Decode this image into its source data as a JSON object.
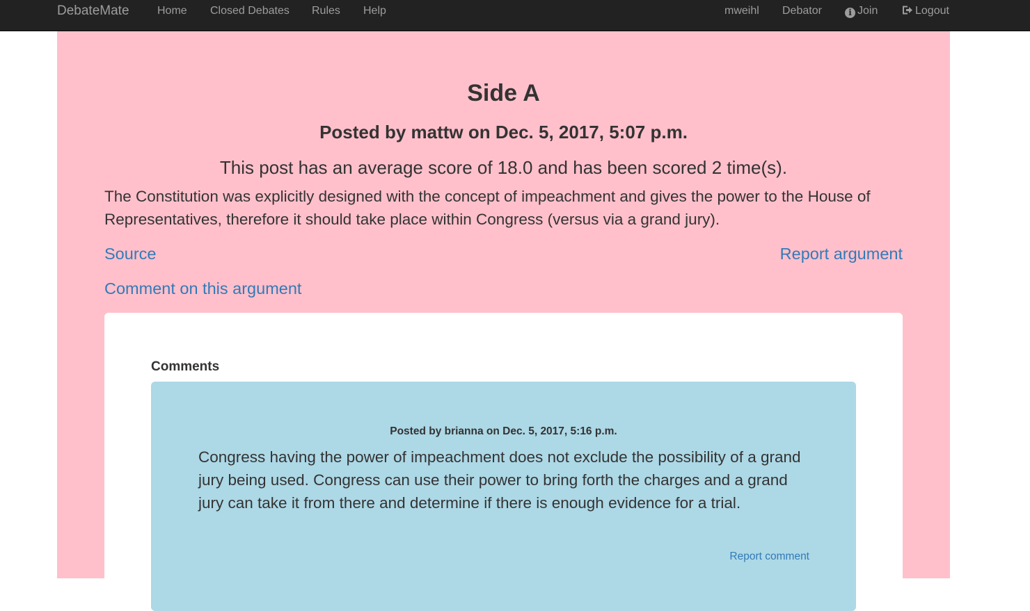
{
  "navbar": {
    "brand": "DebateMate",
    "links": [
      "Home",
      "Closed Debates",
      "Rules",
      "Help"
    ],
    "username": "mweihl",
    "role": "Debator",
    "join_label": "Join",
    "logout_label": "Logout"
  },
  "colors": {
    "navbar_bg": "#222222",
    "panel_bg": "#ffc0cb",
    "comment_bg": "#add8e6",
    "link": "#337ab7"
  },
  "argument": {
    "side_title": "Side A",
    "posted_by": "Posted by mattw on Dec. 5, 2017, 5:07 p.m.",
    "score_line": "This post has an average score of 18.0 and has been scored 2 time(s).",
    "text": "The Constitution was explicitly designed with the concept of impeachment and gives the power to the House of Representatives, therefore it should take place within Congress (versus via a grand jury).",
    "source_label": "Source",
    "report_label": "Report argument",
    "comment_label": "Comment on this argument"
  },
  "comments": {
    "heading": "Comments",
    "items": [
      {
        "meta": "Posted by brianna on Dec. 5, 2017, 5:16 p.m.",
        "text": "Congress having the power of impeachment does not exclude the possibility of a grand jury being used. Congress can use their power to bring forth the charges and a grand jury can take it from there and determine if there is enough evidence for a trial.",
        "report_label": "Report comment"
      }
    ]
  }
}
